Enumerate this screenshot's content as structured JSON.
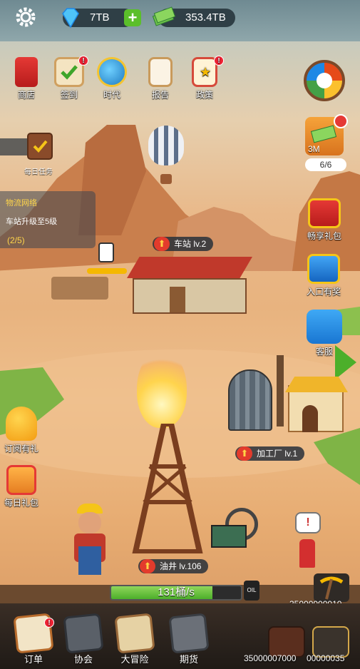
{
  "top": {
    "diamonds": "7TB",
    "cash": "353.4TB"
  },
  "menu": {
    "shop": "商店",
    "signin": "签到",
    "era": "时代",
    "report": "报告",
    "policy": "政策"
  },
  "daily_task": "每日任务",
  "quest": {
    "title": "物流网络",
    "desc": "车站升级至5级",
    "progress": "(2/5)"
  },
  "side": {
    "cash_reward": "3M",
    "cash_count": "6/6",
    "gift_pack": "畅享礼包",
    "entry_reward": "入口有奖",
    "service": "客服",
    "subscribe": "订阅有礼",
    "daily_gift": "每日礼包"
  },
  "buildings": {
    "station": "车站 lv.2",
    "factory": "加工厂 lv.1",
    "well": "油井 lv.106"
  },
  "production": {
    "rate": "131桶/s",
    "fill": 0.78
  },
  "counters": {
    "pickaxe": "35000000010",
    "bottom_left": "35000007000",
    "bottom_right": "00000035"
  },
  "bottom_nav": {
    "orders": "订单",
    "association": "协会",
    "adventure": "大冒险",
    "futures": "期货"
  },
  "colors": {
    "accent_green": "#4caf2a",
    "badge_red": "#e23b2c"
  }
}
